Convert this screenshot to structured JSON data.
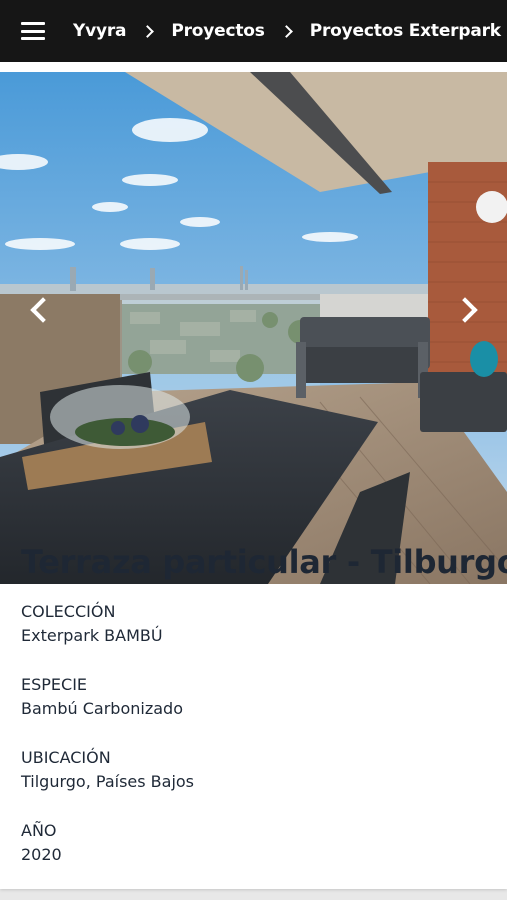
{
  "nav": {
    "menu_icon": "hamburger-menu-icon",
    "breadcrumbs": [
      "Yvyra",
      "Proyectos",
      "Proyectos Exterpark BAMBÚ"
    ],
    "separator_icon": "chevron-right-icon"
  },
  "gallery": {
    "prev_icon": "chevron-left-icon",
    "next_icon": "chevron-right-icon"
  },
  "project": {
    "title": "Terraza particular - Tilburgo",
    "fields": [
      {
        "label": "COLECCIÓN",
        "value": "Exterpark BAMBÚ"
      },
      {
        "label": "ESPECIE",
        "value": "Bambú Carbonizado"
      },
      {
        "label": "UBICACIÓN",
        "value": "Tilgurgo, Países Bajos"
      },
      {
        "label": "AÑO",
        "value": "2020"
      }
    ]
  },
  "colors": {
    "topbar": "#161616",
    "page_background": "#e8e8e8",
    "card": "#ffffff",
    "text": "#1e2734"
  }
}
